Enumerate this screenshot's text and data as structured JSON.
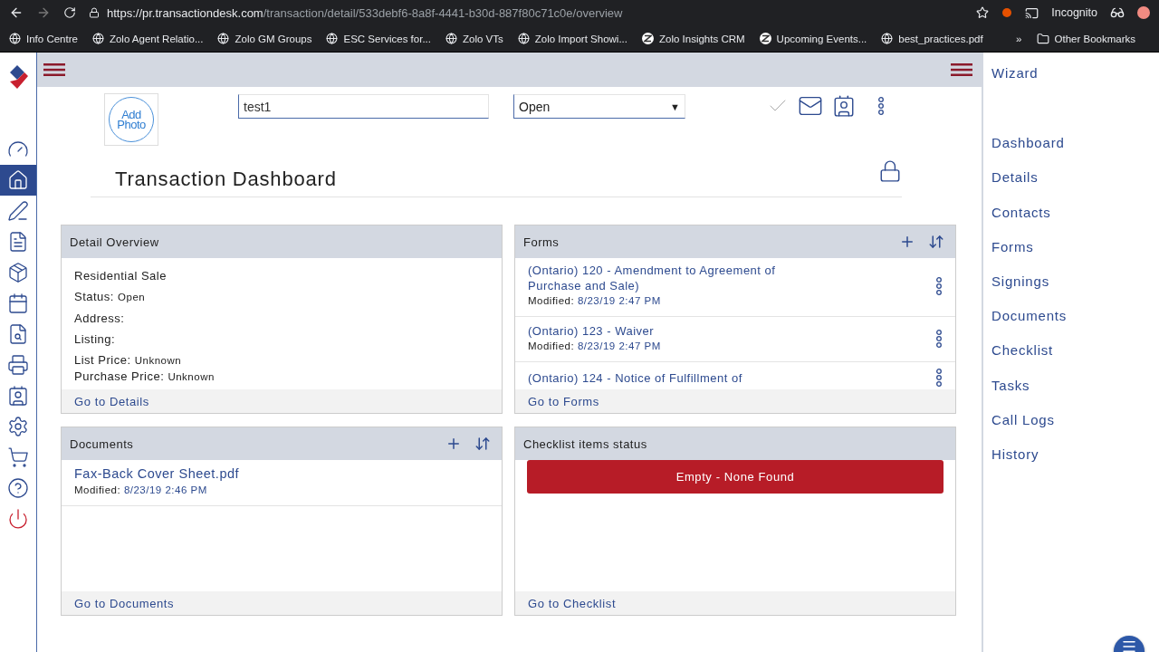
{
  "browser": {
    "url_host": "https://pr.transactiondesk.com",
    "url_path": "/transaction/detail/533debf6-8a8f-4441-b30d-887f80c71c0e/overview",
    "profile": "Incognito",
    "bookmarks": [
      {
        "label": "Info Centre",
        "kind": "globe"
      },
      {
        "label": "Zolo Agent Relatio...",
        "kind": "globe"
      },
      {
        "label": "Zolo GM Groups",
        "kind": "globe"
      },
      {
        "label": "ESC Services for...",
        "kind": "globe"
      },
      {
        "label": "Zolo VTs",
        "kind": "globe"
      },
      {
        "label": "Zolo Import Showi...",
        "kind": "globe"
      },
      {
        "label": "Zolo Insights CRM",
        "kind": "zolo"
      },
      {
        "label": "Upcoming Events...",
        "kind": "zolo"
      },
      {
        "label": "best_practices.pdf",
        "kind": "globe"
      }
    ],
    "overflow": "»",
    "other_bookmarks": "Other Bookmarks"
  },
  "rail": [
    {
      "selected": false
    },
    {
      "selected": true
    },
    {
      "selected": false
    },
    {
      "selected": false
    },
    {
      "selected": false
    },
    {
      "selected": false
    },
    {
      "selected": false
    },
    {
      "selected": false
    },
    {
      "selected": false
    },
    {
      "selected": false
    },
    {
      "selected": false
    },
    {
      "selected": false
    },
    {
      "selected": false
    }
  ],
  "header": {
    "photo_line1": "Add",
    "photo_line2": "Photo",
    "name_value": "test1",
    "status": "Open",
    "status_caret": "▼",
    "title": "Transaction Dashboard"
  },
  "detail": {
    "title": "Detail Overview",
    "lines": [
      {
        "label": "Residential Sale"
      },
      {
        "label": "Status:",
        "value": "Open"
      },
      {
        "label": "Address:"
      },
      {
        "label": "Listing:"
      },
      {
        "label": "List Price:",
        "value": "Unknown"
      },
      {
        "label": "Purchase Price:",
        "value": "Unknown"
      }
    ],
    "footer": "Go to Details"
  },
  "forms": {
    "title": "Forms",
    "items": [
      {
        "title": "(Ontario) 120 - Amendment to Agreement of Purchase and Sale)",
        "modified_label": "Modified:",
        "modified": "8/23/19 2:47 PM"
      },
      {
        "title": "(Ontario) 123 - Waiver",
        "modified_label": "Modified:",
        "modified": "8/23/19 2:47 PM"
      },
      {
        "title": "(Ontario) 124 - Notice of Fulfillment of"
      }
    ],
    "footer": "Go to Forms"
  },
  "documents": {
    "title": "Documents",
    "items": [
      {
        "title": "Fax-Back Cover Sheet.pdf",
        "modified_label": "Modified:",
        "modified": "8/23/19 2:46 PM"
      }
    ],
    "footer": "Go to Documents"
  },
  "checklist": {
    "title": "Checklist items status",
    "empty": "Empty - None Found",
    "footer": "Go to Checklist"
  },
  "side_nav": {
    "wizard": "Wizard",
    "items": [
      "Dashboard",
      "Details",
      "Contacts",
      "Forms",
      "Signings",
      "Documents",
      "Checklist",
      "Tasks",
      "Call Logs",
      "History"
    ]
  }
}
